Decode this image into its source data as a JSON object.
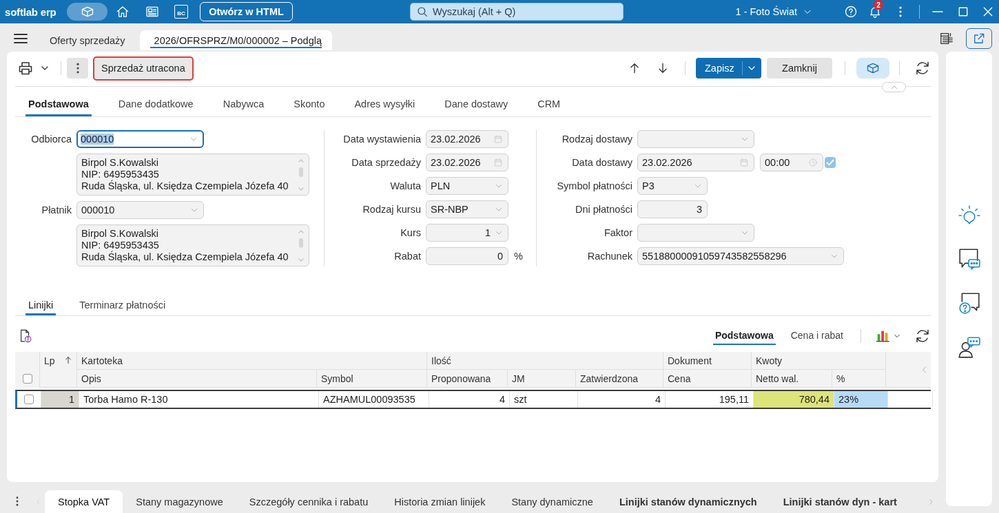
{
  "topbar": {
    "logo": "softlab erp",
    "bc_label": "BC",
    "open_html_button": "Otwórz w HTML",
    "search": {
      "placeholder": "Wyszukaj (Alt + Q)"
    },
    "company": "1 - Foto Świat",
    "notification_count": "2"
  },
  "document_tabs": [
    {
      "label": "Oferty sprzedaży",
      "selected": false
    },
    {
      "label": "2026/OFRSPRZ/M0/000002 – Podglą",
      "selected": true
    }
  ],
  "toolbar": {
    "lost_sale_button": "Sprzedaż utracona",
    "save_button": "Zapisz",
    "close_button": "Zamknij"
  },
  "form_tabs": [
    {
      "label": "Podstawowa",
      "selected": true
    },
    {
      "label": "Dane dodatkowe",
      "selected": false
    },
    {
      "label": "Nabywca",
      "selected": false
    },
    {
      "label": "Skonto",
      "selected": false
    },
    {
      "label": "Adres wysyłki",
      "selected": false
    },
    {
      "label": "Dane dostawy",
      "selected": false
    },
    {
      "label": "CRM",
      "selected": false
    }
  ],
  "form": {
    "columns": [
      {
        "fields": [
          {
            "kind": "select",
            "label": "Odbiorca",
            "value": "000010",
            "focused": true
          },
          {
            "kind": "address",
            "lines": [
              "Birpol S.Kowalski",
              "NIP: 6495953435",
              "Ruda Śląska, ul. Księdza Czempiela Józefa 40"
            ]
          },
          {
            "kind": "select",
            "label": "Płatnik",
            "value": "000010",
            "focused": false
          },
          {
            "kind": "address",
            "lines": [
              "Birpol S.Kowalski",
              "NIP: 6495953435",
              "Ruda Śląska, ul. Księdza Czempiela Józefa 40"
            ]
          }
        ]
      },
      {
        "fields": [
          {
            "kind": "date",
            "label": "Data wystawienia",
            "value": "23.02.2026"
          },
          {
            "kind": "date",
            "label": "Data sprzedaży",
            "value": "23.02.2026"
          },
          {
            "kind": "select",
            "label": "Waluta",
            "value": "PLN"
          },
          {
            "kind": "select",
            "label": "Rodzaj kursu",
            "value": "SR-NBP"
          },
          {
            "kind": "number_select",
            "label": "Kurs",
            "value": "1"
          },
          {
            "kind": "number",
            "label": "Rabat",
            "value": "0",
            "unit": "%"
          }
        ]
      },
      {
        "fields": [
          {
            "kind": "select",
            "label": "Rodzaj dostawy"
          },
          {
            "kind": "datetime",
            "label": "Data dostawy",
            "value": "23.02.2026",
            "time": "00:00",
            "checked": true
          },
          {
            "kind": "select",
            "label": "Symbol płatności",
            "value": "P3"
          },
          {
            "kind": "number",
            "label": "Dni płatności",
            "value": "3"
          },
          {
            "kind": "select",
            "label": "Faktor"
          },
          {
            "kind": "select",
            "label": "Rachunek",
            "value": "55188000091059743582558296"
          }
        ]
      }
    ]
  },
  "lines_tabs": [
    {
      "label": "Linijki",
      "selected": true
    },
    {
      "label": "Terminarz płatności",
      "selected": false
    }
  ],
  "view_tabs": [
    {
      "label": "Podstawowa",
      "selected": true
    },
    {
      "label": "Cena i rabat",
      "selected": false
    }
  ],
  "table": {
    "lp_header": "Lp",
    "select_all_checked": false,
    "groups": [
      {
        "label": "Kartoteka",
        "columns": [
          "Opis",
          "Symbol"
        ]
      },
      {
        "label": "Ilość",
        "columns": [
          "Proponowana",
          "JM",
          "Zatwierdzona"
        ]
      },
      {
        "label": "Dokument",
        "columns": [
          "Cena"
        ]
      },
      {
        "label": "Kwoty",
        "columns": [
          "Netto wal.",
          "%"
        ]
      }
    ],
    "rows": [
      {
        "selected": true,
        "checked": false,
        "lp": "1",
        "cells": [
          {
            "text": "Torba Hamo R-130"
          },
          {
            "text": "AZHAMUL00093535"
          },
          {
            "text": "4"
          },
          {
            "text": "szt"
          },
          {
            "text": "4"
          },
          {
            "text": "195,11"
          },
          {
            "text": "780,44",
            "color": "#dde479"
          },
          {
            "text": "23%",
            "color": "#b7dbf5"
          }
        ]
      }
    ]
  },
  "bottom_tabs": [
    {
      "label": "Stopka VAT",
      "selected": true,
      "emphasized": false
    },
    {
      "label": "Stany magazynowe",
      "selected": false,
      "emphasized": false
    },
    {
      "label": "Szczegóły cennika i rabatu",
      "selected": false,
      "emphasized": false
    },
    {
      "label": "Historia zmian linijek",
      "selected": false,
      "emphasized": false
    },
    {
      "label": "Stany dynamiczne",
      "selected": false,
      "emphasized": false
    },
    {
      "label": "Linijki stanów dynamicznych",
      "selected": false,
      "emphasized": true
    },
    {
      "label": "Linijki stanów dyn - kart",
      "selected": false,
      "emphasized": true
    }
  ]
}
